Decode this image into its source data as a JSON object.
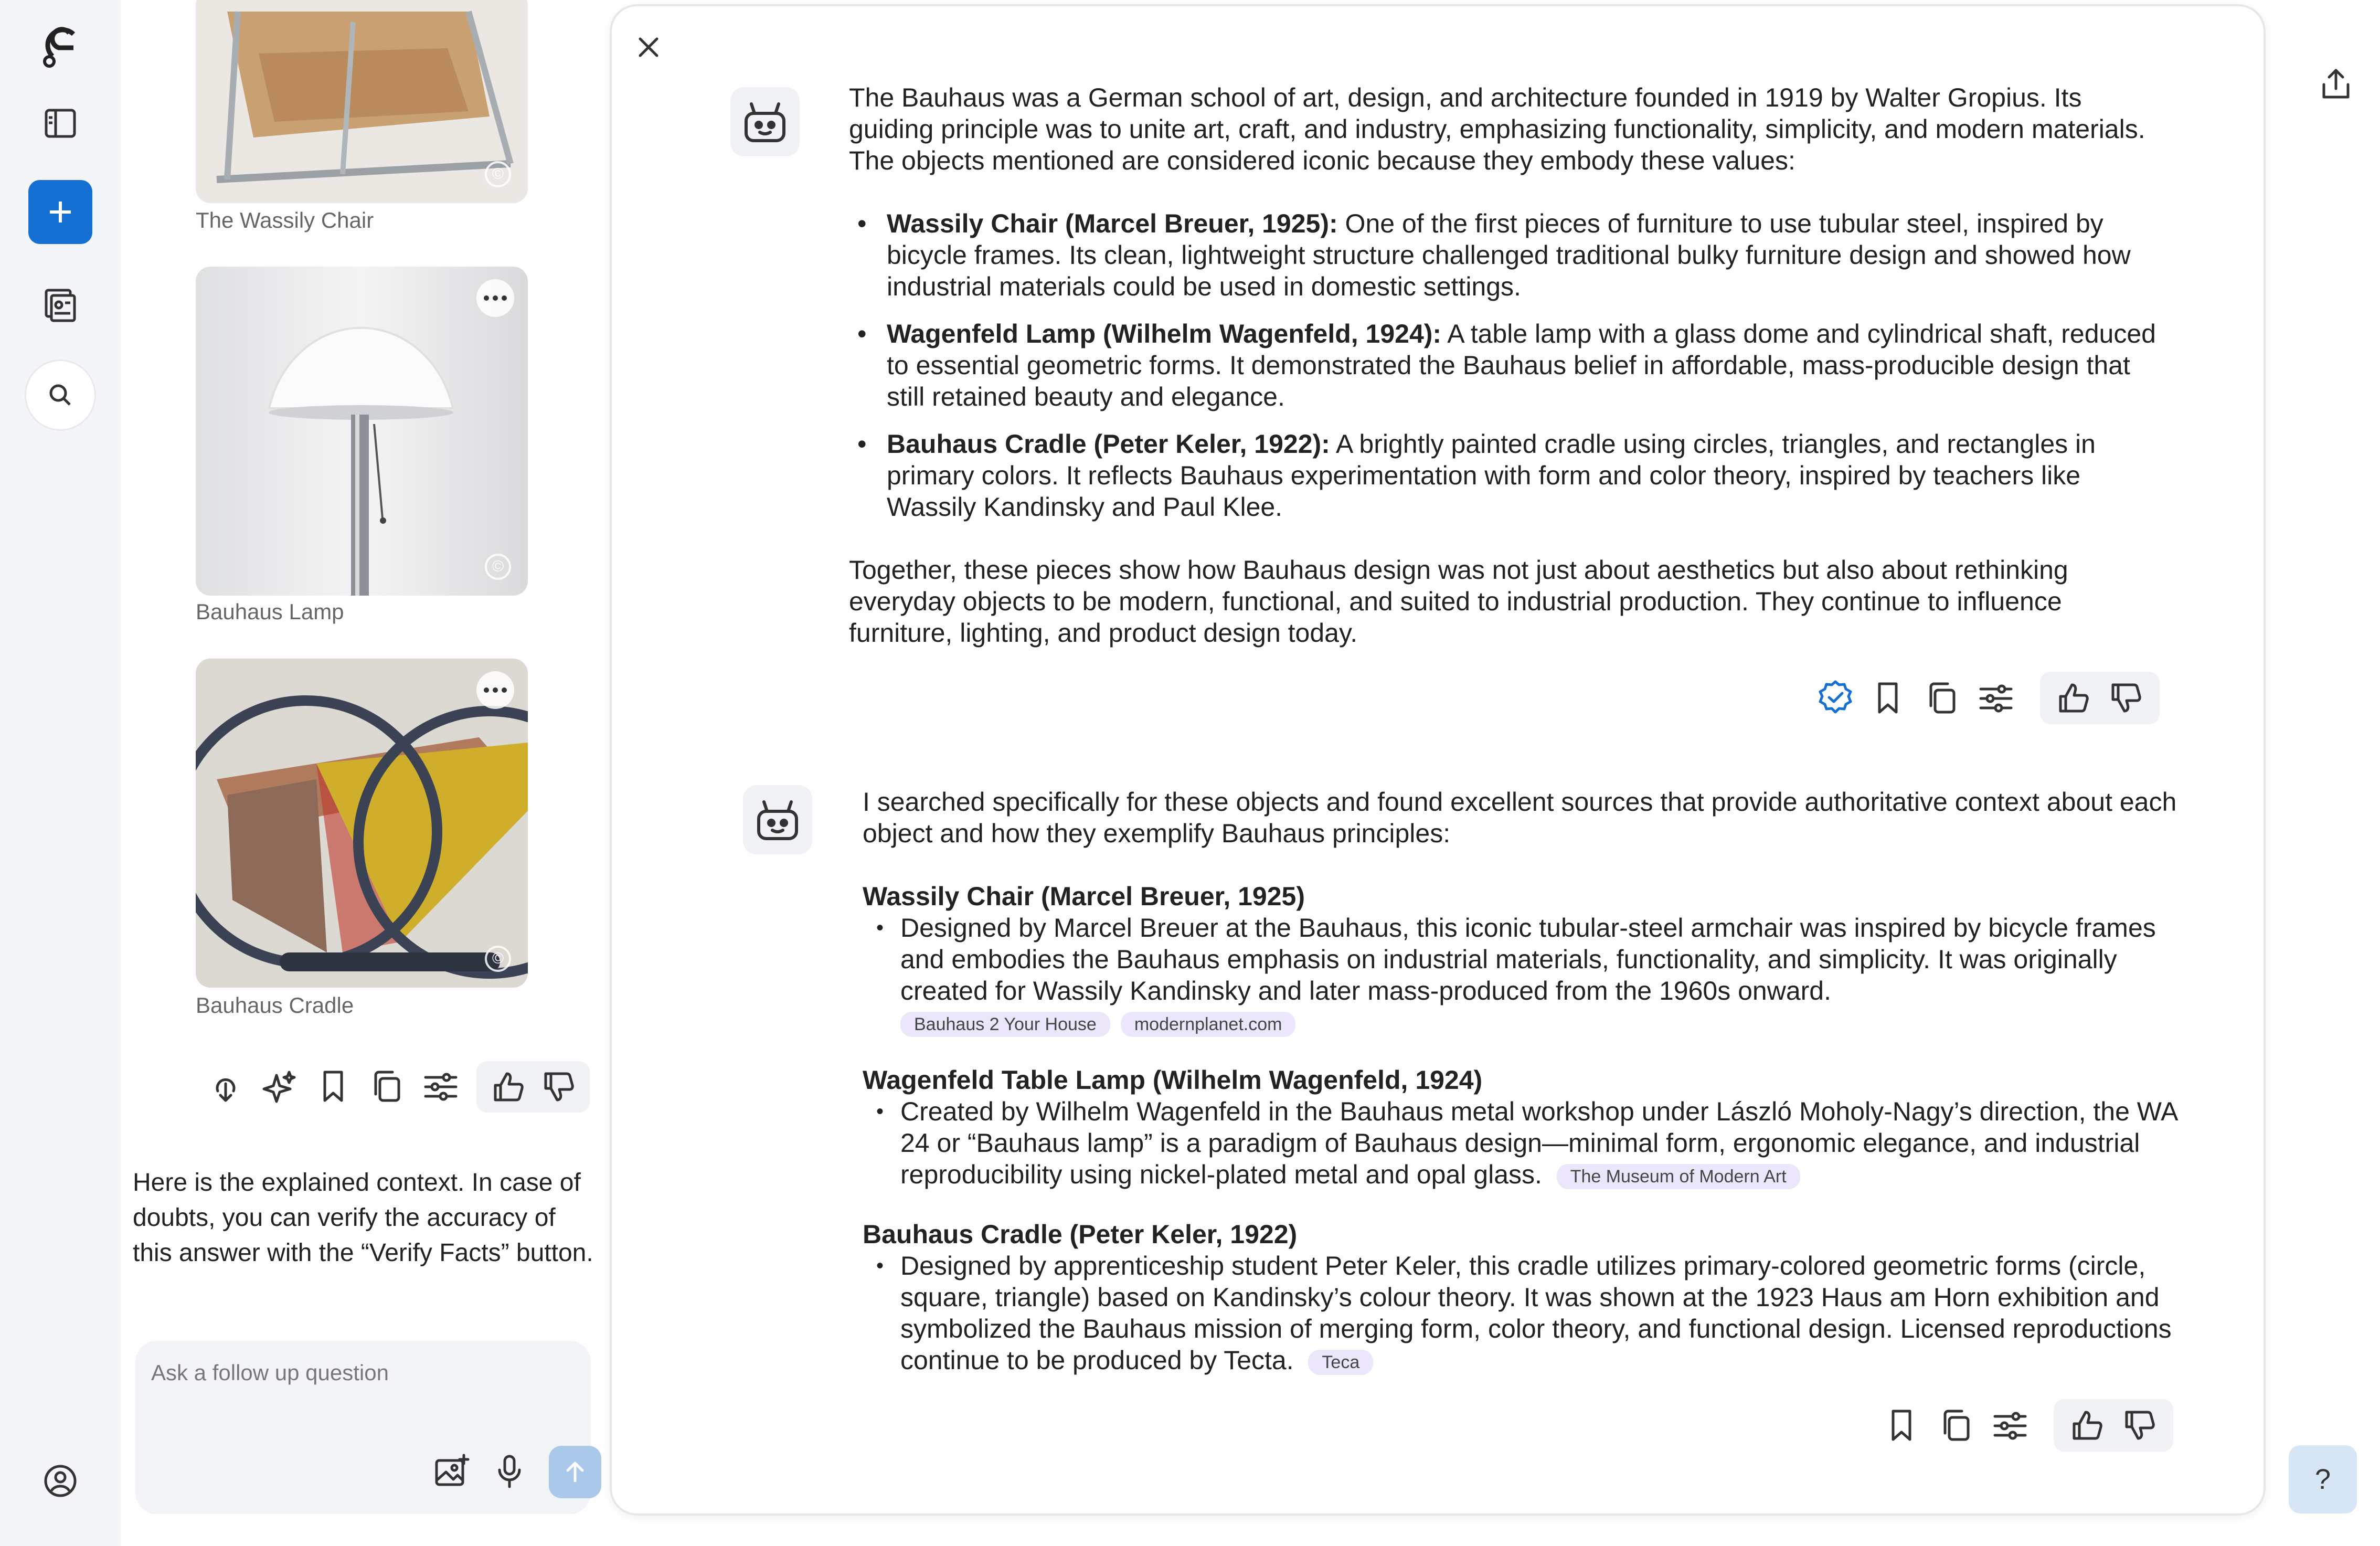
{
  "colors": {
    "accent": "#1670d3",
    "rail_bg": "#f4f5f8",
    "tag_bg": "#ece6fb",
    "send_bg": "#a9c8ea"
  },
  "rail": {
    "icons": [
      "logo-icon",
      "sidebar-toggle-icon",
      "new-chat-icon",
      "library-icon",
      "search-icon",
      "account-icon"
    ]
  },
  "gallery": {
    "items": [
      {
        "caption": "The Wassily Chair",
        "icon": "chair-image"
      },
      {
        "caption": "Bauhaus Lamp",
        "icon": "lamp-image"
      },
      {
        "caption": "Bauhaus Cradle",
        "icon": "cradle-image"
      }
    ]
  },
  "left_toolbar": {
    "icons": [
      "download-icon",
      "sparkle-icon",
      "bookmark-icon",
      "copy-icon",
      "sliders-icon",
      "thumbs-up-icon",
      "thumbs-down-icon"
    ]
  },
  "left_note": "Here is the explained context. In case of doubts, you can verify the accuracy of this answer with the “Verify Facts” button.",
  "followup": {
    "placeholder": "Ask a follow up question"
  },
  "help": {
    "label": "?"
  },
  "answer1": {
    "intro": "The Bauhaus was a German school of art, design, and architecture founded in 1919 by Walter Gropius. Its guiding principle was to unite art, craft, and industry, emphasizing functionality, simplicity, and modern materials. The objects mentioned are considered iconic because they embody these values:",
    "bullets": [
      {
        "title": "Wassily Chair (Marcel Breuer, 1925):",
        "text": " One of the first pieces of furniture to use tubular steel, inspired by bicycle frames. Its clean, lightweight structure challenged traditional bulky furniture design and showed how industrial materials could be used in domestic settings."
      },
      {
        "title": "Wagenfeld Lamp (Wilhelm Wagenfeld, 1924):",
        "text": " A table lamp with a glass dome and cylindrical shaft, reduced to essential geometric forms. It demonstrated the Bauhaus belief in affordable, mass-producible design that still retained beauty and elegance."
      },
      {
        "title": "Bauhaus Cradle (Peter Keler, 1922):",
        "text": " A brightly painted cradle using circles, triangles, and rectangles in primary colors. It reflects Bauhaus experimentation with form and color theory, inspired by teachers like Wassily Kandinsky and Paul Klee."
      }
    ],
    "outro": "Together, these pieces show how Bauhaus design was not just about aesthetics but also about rethinking everyday objects to be modern, functional, and suited to industrial production. They continue to influence furniture, lighting, and product design today."
  },
  "answer2": {
    "intro": "I searched specifically for these objects and found excellent sources that provide authoritative context about each object and how they exemplify Bauhaus principles:",
    "sections": [
      {
        "title": "Wassily Chair (Marcel Breuer, 1925)",
        "text": "Designed by Marcel Breuer at the Bauhaus, this iconic tubular-steel armchair was inspired by bicycle frames and embodies the Bauhaus emphasis on industrial materials, functionality, and simplicity. It was originally created for Wassily Kandinsky and later mass-produced from the 1960s onward.",
        "sources": [
          "Bauhaus 2 Your House",
          "modernplanet.com"
        ]
      },
      {
        "title": "Wagenfeld Table Lamp (Wilhelm Wagenfeld, 1924)",
        "text": "Created by Wilhelm Wagenfeld in the Bauhaus metal workshop under László Moholy-Nagy’s direction, the WA 24 or “Bauhaus lamp” is a paradigm of Bauhaus design—minimal form, ergonomic elegance, and industrial reproducibility using nickel-plated metal and opal glass.",
        "sources": [
          "The Museum of Modern Art"
        ]
      },
      {
        "title": "Bauhaus Cradle (Peter Keler, 1922)",
        "text": "Designed by apprenticeship student Peter Keler, this cradle utilizes primary-colored geometric forms (circle, square, triangle) based on Kandinsky’s colour theory. It was shown at the 1923 Haus am Horn exhibition and symbolized the Bauhaus mission of merging form, color theory, and functional design. Licensed reproductions continue to be produced by Tecta.",
        "sources": [
          "Teca"
        ]
      }
    ]
  }
}
